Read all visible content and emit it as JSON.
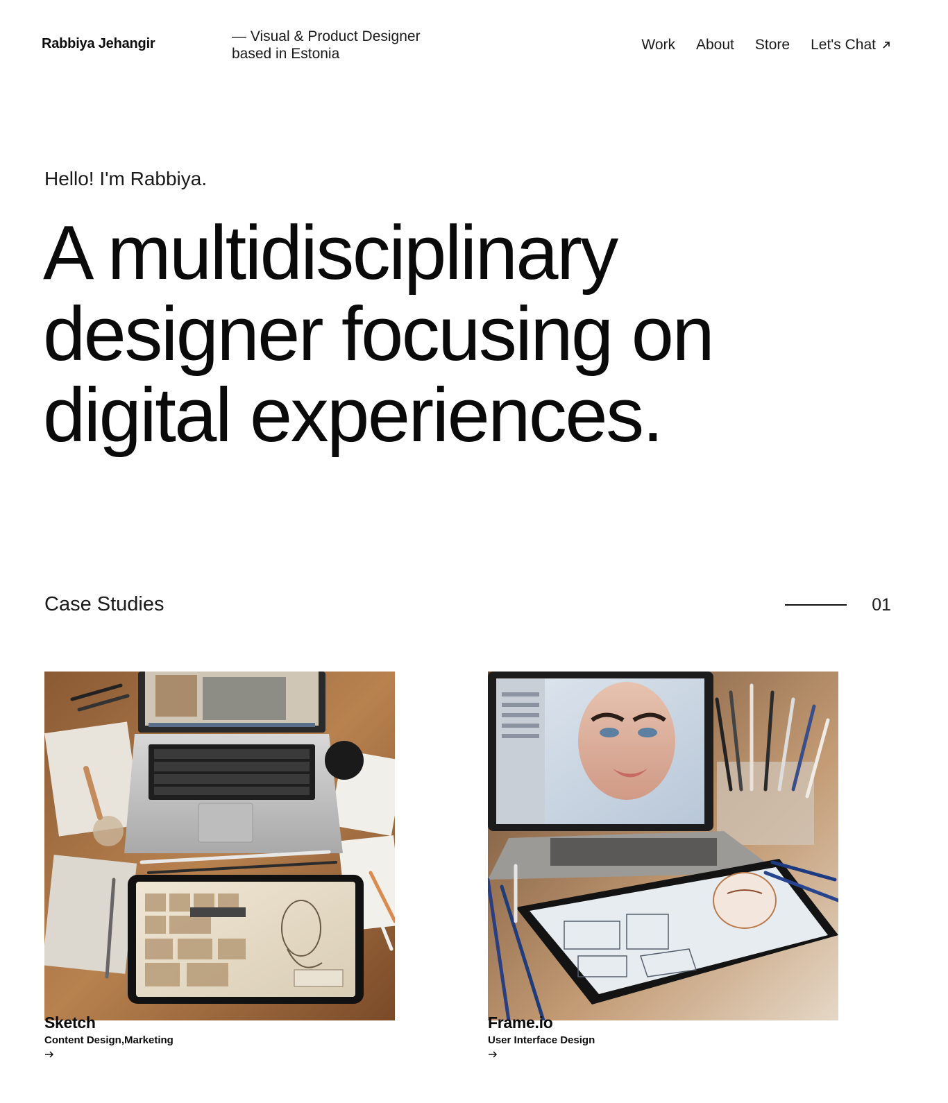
{
  "header": {
    "brand": "Rabbiya Jehangir",
    "tagline_line1": "— Visual & Product Designer",
    "tagline_line2": "based in Estonia",
    "nav": [
      {
        "label": "Work"
      },
      {
        "label": "About"
      },
      {
        "label": "Store"
      },
      {
        "label": "Let's Chat",
        "icon": "arrow-up-right-icon"
      }
    ]
  },
  "hero": {
    "greeting": "Hello! I'm Rabbiya.",
    "headline_lines": [
      "A multidisciplinary",
      "designer focusing on",
      "digital experiences."
    ]
  },
  "case_studies": {
    "title": "Case Studies",
    "count": "01",
    "items": [
      {
        "title": "Sketch",
        "tags": "Content Design,Marketing",
        "image": "designer-desk-laptop-tablet-sketches",
        "icon": "arrow-right-icon"
      },
      {
        "title": "Frame.io",
        "tags": "User Interface Design",
        "image": "laptop-tablet-face-illustration-desk",
        "icon": "arrow-right-icon"
      }
    ]
  }
}
